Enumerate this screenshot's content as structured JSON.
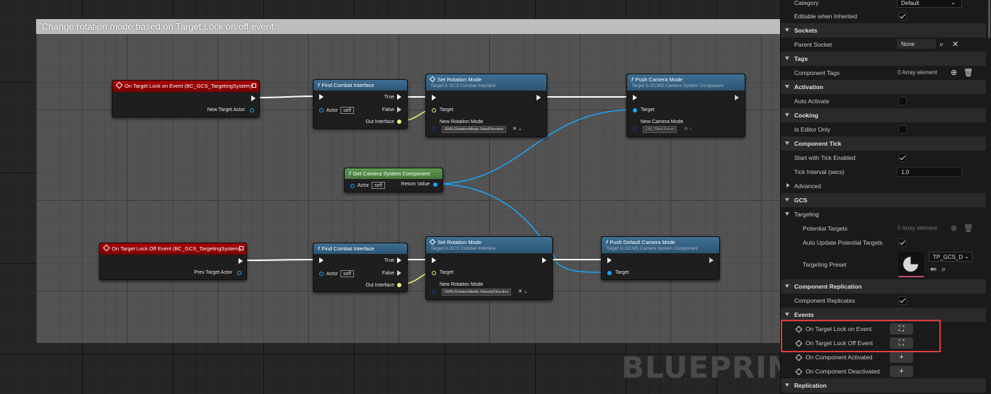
{
  "comment": {
    "title": "Change rotation mode based on Target Lock on/off event."
  },
  "watermark": "BLUEPRINT",
  "nodes": {
    "event_on": {
      "title": "On Target Lock on Event (BC_GCS_TargetingSystem)",
      "pin_out": "New Target Actor"
    },
    "find1": {
      "title": "Find Combat Interface",
      "pin_actor": "Actor",
      "pin_self": "self",
      "pin_true": "True",
      "pin_false": "False",
      "pin_out": "Out Interface"
    },
    "setrot1": {
      "title": "Set Rotation Mode",
      "subtitle": "Target is GCS Combat Interface",
      "pin_target": "Target",
      "pin_mode": "New Rotation Mode",
      "mode_value": "GMS.RotationMode.ViewDirection"
    },
    "push1": {
      "title": "Push Camera Mode",
      "subtitle": "Target is GCMS Camera System Component",
      "pin_target": "Target",
      "pin_mode": "New Camera Mode",
      "mode_value": "CM_Third Perso"
    },
    "getcam": {
      "title": "Get Camera System Component",
      "pin_actor": "Actor",
      "pin_self": "self",
      "pin_return": "Return Value"
    },
    "event_off": {
      "title": "On Target Lock Off Event (BC_GCS_TargetingSystem)",
      "pin_out": "Prev Target Actor"
    },
    "find2": {
      "title": "Find Combat Interface",
      "pin_actor": "Actor",
      "pin_self": "self",
      "pin_true": "True",
      "pin_false": "False",
      "pin_out": "Out Interface"
    },
    "setrot2": {
      "title": "Set Rotation Mode",
      "subtitle": "Target is GCS Combat Interface",
      "pin_target": "Target",
      "pin_mode": "New Rotation Mode",
      "mode_value": "GMS.RotationMode.VelocityDirection"
    },
    "pushdef": {
      "title": "Push Default Camera Mode",
      "subtitle": "Target is GCMS Camera System Component",
      "pin_target": "Target"
    }
  },
  "details": {
    "category_label": "Category",
    "category_value": "Default",
    "editable_label": "Editable when Inherited",
    "sockets": "Sockets",
    "parent_socket_label": "Parent Socket",
    "parent_socket_value": "None",
    "tags": "Tags",
    "component_tags_label": "Component Tags",
    "component_tags_value": "0 Array element",
    "activation": "Activation",
    "auto_activate_label": "Auto Activate",
    "cooking": "Cooking",
    "editor_only_label": "Is Editor Only",
    "component_tick": "Component Tick",
    "start_tick_label": "Start with Tick Enabled",
    "tick_interval_label": "Tick Interval (secs)",
    "tick_interval_value": "1.0",
    "advanced": "Advanced",
    "gcs": "GCS",
    "targeting": "Targeting",
    "potential_targets_label": "Potential Targets",
    "potential_targets_value": "0 Array element",
    "auto_update_label": "Auto Update Potential Targets",
    "targeting_preset_label": "Targeting Preset",
    "targeting_preset_value": "TP_GCS_D",
    "component_replication": "Component Replication",
    "component_replicates_label": "Component Replicates",
    "events": "Events",
    "event_lock_on": "On Target Lock on Event",
    "event_lock_off": "On Target Lock Off Event",
    "event_activated": "On Component Activated",
    "event_deactivated": "On Component Deactivated",
    "replication": "Replication"
  }
}
